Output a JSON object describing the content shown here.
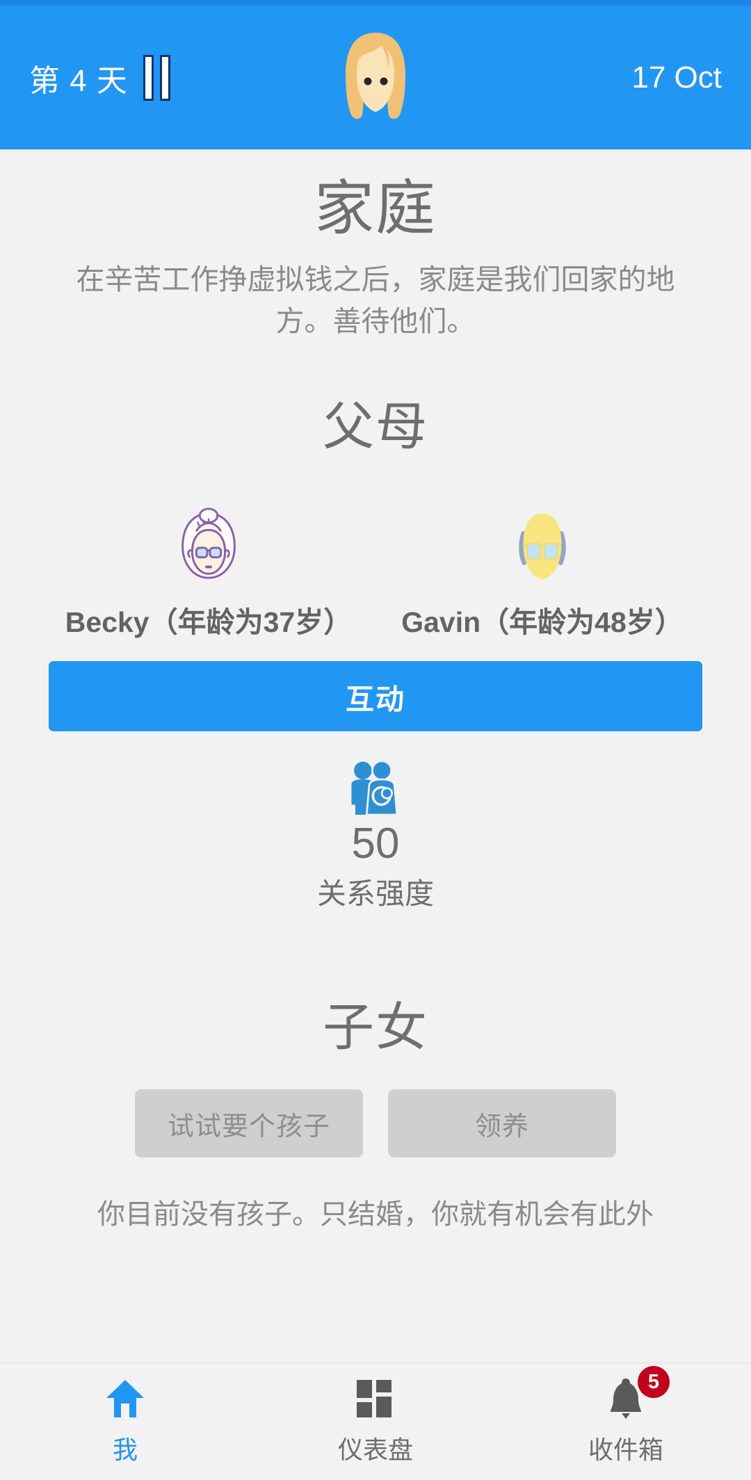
{
  "header": {
    "day_label": "第 4 天",
    "pause_icon": "pause-icon",
    "avatar_icon": "woman-avatar",
    "date": "17 Oct"
  },
  "main": {
    "page_title": "家庭",
    "page_subtitle": "在辛苦工作挣虚拟钱之后，家庭是我们回家的地方。善待他们。",
    "parents": {
      "section_title": "父母",
      "members": [
        {
          "label": "Becky（年龄为37岁）",
          "name": "Becky",
          "age": 37,
          "avatar": "grandmother-face"
        },
        {
          "label": "Gavin（年龄为48岁）",
          "name": "Gavin",
          "age": 48,
          "avatar": "grandfather-face"
        }
      ],
      "interact_button": "互动",
      "stat": {
        "icon": "family-couple-baby-icon",
        "value": "50",
        "label": "关系强度"
      }
    },
    "children": {
      "section_title": "子女",
      "actions": [
        {
          "label": "试试要个孩子"
        },
        {
          "label": "领养"
        }
      ],
      "note": "你目前没有孩子。只结婚，你就有机会有此外"
    }
  },
  "bottom_nav": {
    "items": [
      {
        "label": "我",
        "icon": "home-icon",
        "active": true,
        "badge": ""
      },
      {
        "label": "仪表盘",
        "icon": "dashboard-grid-icon",
        "active": false,
        "badge": ""
      },
      {
        "label": "收件箱",
        "icon": "bell-icon",
        "active": false,
        "badge": "5"
      }
    ]
  },
  "colors": {
    "accent": "#2196f3",
    "header_bg": "#2196f3",
    "page_bg": "#f2f2f2",
    "text_gray": "#6e6e6e",
    "muted_gray": "#8a8a8a",
    "disabled_btn": "#cfcfcf",
    "badge_red": "#c2001b"
  }
}
